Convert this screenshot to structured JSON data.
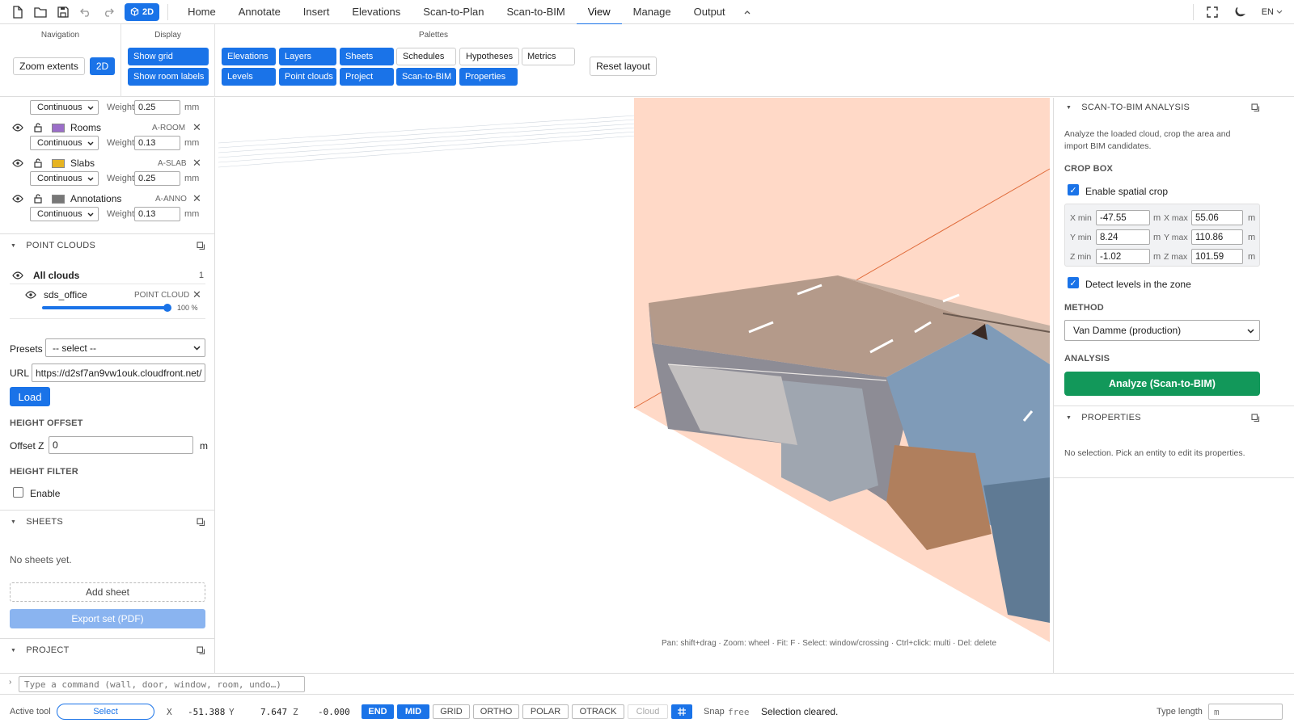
{
  "topbar": {
    "mode_badge": "2D",
    "tabs": [
      "Home",
      "Annotate",
      "Insert",
      "Elevations",
      "Scan-to-Plan",
      "Scan-to-BIM",
      "View",
      "Manage",
      "Output"
    ],
    "active_tab": "View",
    "language": "EN"
  },
  "ribbon": {
    "navigation": {
      "title": "Navigation",
      "zoom_extents": "Zoom extents",
      "mode_2d": "2D"
    },
    "display": {
      "title": "Display",
      "show_grid": "Show grid",
      "show_room_labels": "Show room labels"
    },
    "palettes": {
      "title": "Palettes",
      "row1": [
        "Elevations",
        "Layers",
        "Sheets",
        "Schedules",
        "Hypotheses",
        "Metrics"
      ],
      "row2": [
        "Levels",
        "Point clouds",
        "Project",
        "Scan-to-BIM",
        "Properties"
      ],
      "reset_layout": "Reset layout"
    }
  },
  "layers": {
    "top_row": {
      "linetype": "Continuous",
      "weight_label": "Weight",
      "weight": "0.25",
      "unit": "mm"
    },
    "items": [
      {
        "name": "Rooms",
        "code": "A-ROOM",
        "color": "#9b6ec9",
        "linetype": "Continuous",
        "weight_label": "Weight",
        "weight": "0.13",
        "unit": "mm"
      },
      {
        "name": "Slabs",
        "code": "A-SLAB",
        "color": "#e6b422",
        "linetype": "Continuous",
        "weight_label": "Weight",
        "weight": "0.25",
        "unit": "mm"
      },
      {
        "name": "Annotations",
        "code": "A-ANNO",
        "color": "#777777",
        "linetype": "Continuous",
        "weight_label": "Weight",
        "weight": "0.13",
        "unit": "mm"
      }
    ]
  },
  "point_clouds": {
    "title": "POINT CLOUDS",
    "all_clouds": "All clouds",
    "count": "1",
    "item_name": "sds_office",
    "item_type": "POINT CLOUD",
    "opacity": "100 %",
    "opacity_value": 1.0,
    "presets_label": "Presets",
    "presets_value": "-- select --",
    "url_label": "URL",
    "url_value": "https://d2sf7an9vw1ouk.cloudfront.net/",
    "load": "Load",
    "height_offset_title": "HEIGHT OFFSET",
    "offset_label": "Offset Z",
    "offset_value": "0",
    "offset_unit": "m",
    "height_filter_title": "HEIGHT FILTER",
    "enable": "Enable"
  },
  "sheets": {
    "title": "SHEETS",
    "empty": "No sheets yet.",
    "add_sheet": "Add sheet",
    "export": "Export set (PDF)"
  },
  "project": {
    "title": "PROJECT"
  },
  "viewport": {
    "hint": "Pan: shift+drag · Zoom: wheel · Fit: F · Select: window/crossing · Ctrl+click: multi · Del: delete"
  },
  "scan_to_bim": {
    "title": "SCAN-TO-BIM ANALYSIS",
    "description": "Analyze the loaded cloud, crop the area and import BIM candidates.",
    "crop_box_title": "CROP BOX",
    "enable_crop": "Enable spatial crop",
    "rows": [
      {
        "min_label": "X min",
        "min": "-47.55",
        "max_label": "X max",
        "max": "55.06"
      },
      {
        "min_label": "Y min",
        "min": "8.24",
        "max_label": "Y max",
        "max": "110.86"
      },
      {
        "min_label": "Z min",
        "min": "-1.02",
        "max_label": "Z max",
        "max": "101.59"
      }
    ],
    "unit": "m",
    "detect_levels": "Detect levels in the zone",
    "method_title": "METHOD",
    "method_value": "Van Damme (production)",
    "analysis_title": "ANALYSIS",
    "analyze_button": "Analyze (Scan-to-BIM)"
  },
  "properties": {
    "title": "PROPERTIES",
    "empty": "No selection. Pick an entity to edit its properties."
  },
  "command": {
    "placeholder": "Type a command (wall, door, window, room, undo…)"
  },
  "status": {
    "active_tool_label": "Active tool",
    "active_tool": "Select",
    "x_label": "X",
    "x": "-51.388",
    "y_label": "Y",
    "y": "7.647",
    "z_label": "Z",
    "z": "-0.000",
    "snaps": [
      {
        "label": "END",
        "on": true
      },
      {
        "label": "MID",
        "on": true
      },
      {
        "label": "GRID",
        "on": false
      },
      {
        "label": "ORTHO",
        "on": false
      },
      {
        "label": "POLAR",
        "on": false
      },
      {
        "label": "OTRACK",
        "on": false
      },
      {
        "label": "Cloud",
        "on": false
      }
    ],
    "snap_label": "Snap",
    "snap_value": "free",
    "message": "Selection cleared.",
    "type_length_label": "Type length",
    "type_length_placeholder": "m"
  },
  "colors": {
    "accent": "#1a73e8",
    "analyze": "#12985a",
    "crop_plane": "#ffd9c7"
  }
}
